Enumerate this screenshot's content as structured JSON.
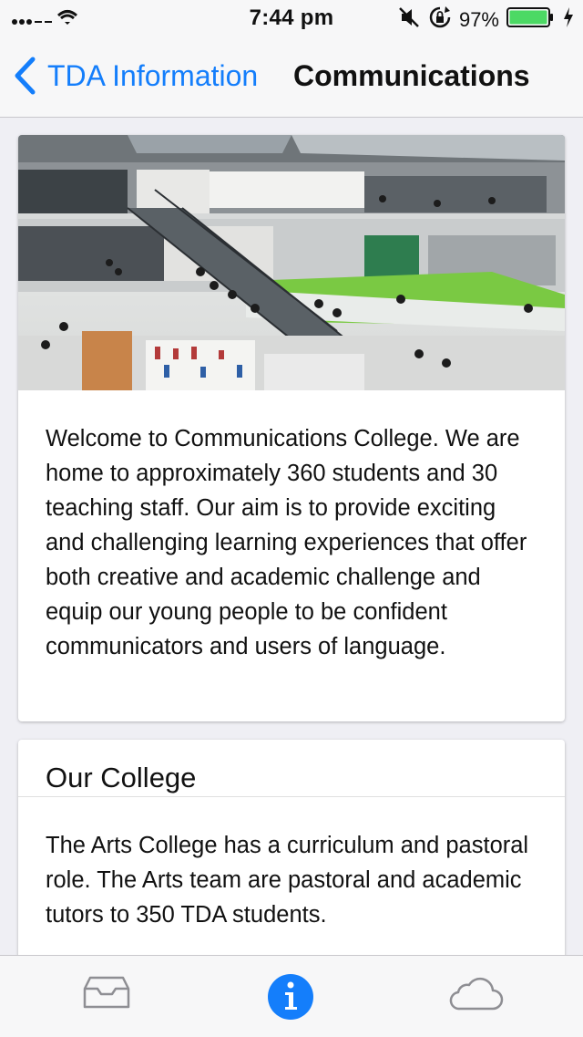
{
  "status_bar": {
    "time": "7:44 pm",
    "battery_percent": "97%",
    "icons": [
      "signal-icon",
      "wifi-icon",
      "mute-icon",
      "rotation-lock-icon",
      "battery-icon",
      "charging-bolt-icon"
    ],
    "battery_color": "#4cd964"
  },
  "nav": {
    "back_label": "TDA Information",
    "title": "Communications",
    "accent_color": "#147efb"
  },
  "intro_card": {
    "image": "atrium-photo",
    "text": "Welcome to Communications College. We are home to approximately 360 students and 30 teaching staff. Our aim is to provide exciting and challenging learning experiences that offer both creative and academic challenge and equip our young people to be confident communicators and users of language."
  },
  "college_card": {
    "title": "Our College",
    "text": "The Arts College has a curriculum and pastoral role. The Arts team are pastoral and academic tutors to 350 TDA students."
  },
  "tab_bar": {
    "tabs": [
      {
        "icon": "inbox-icon",
        "selected": false
      },
      {
        "icon": "info-icon",
        "selected": true
      },
      {
        "icon": "cloud-icon",
        "selected": false
      }
    ]
  }
}
